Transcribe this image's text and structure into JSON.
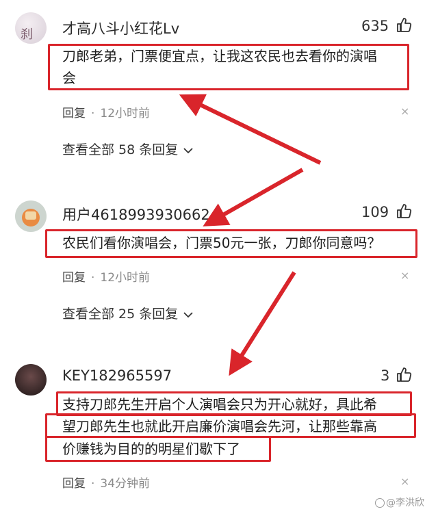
{
  "comments": [
    {
      "username": "才高八斗小红花Lv",
      "likes": "635",
      "avatar_glyph": "刹",
      "content_lines": [
        "刀郎老弟，门票便宜点，让我这农民也去看你的演唱",
        "会"
      ],
      "reply_label": "回复",
      "time": "12小时前",
      "view_all": "查看全部 58 条回复"
    },
    {
      "username": "用户461899393066​24",
      "likes": "109",
      "content_lines": [
        "农民们看你演唱会，门票50元一张，刀郎你同意吗？"
      ],
      "reply_label": "回复",
      "time": "12小时前",
      "view_all": "查看全部 25 条回复"
    },
    {
      "username": "KEY182965597",
      "likes": "3",
      "content_lines": [
        "支持刀郎先生开启个人演唱会只为开心就好，具此希",
        "望刀郎先生也就此开启廉价演唱会先河，让那些靠高",
        "价赚钱为目的的明星们歇下了"
      ],
      "reply_label": "回复",
      "time": "34分钟前"
    }
  ],
  "close_glyph": "×",
  "chevron_glyph": "⌄",
  "watermark": "@李洪欣",
  "annotation_color": "#d9252b"
}
